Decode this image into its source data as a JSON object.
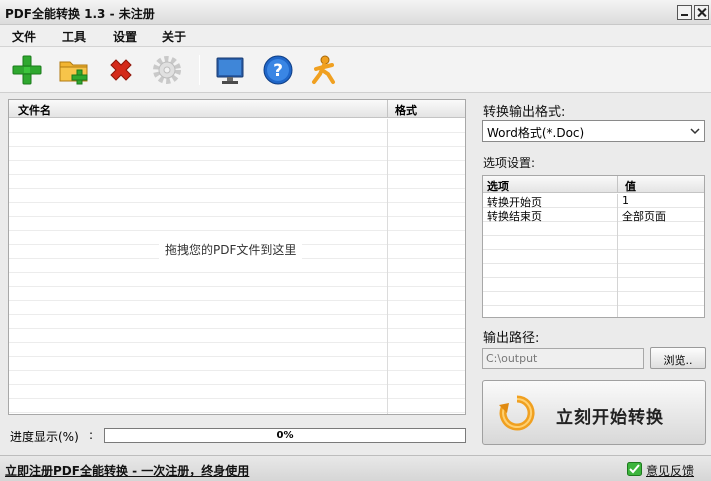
{
  "window": {
    "title": "PDF全能转换 1.3 - 未注册"
  },
  "menu": {
    "items": [
      "文件",
      "工具",
      "设置",
      "关于"
    ]
  },
  "toolbar": {
    "buttons": [
      {
        "icon": "add-file-icon"
      },
      {
        "icon": "add-folder-icon"
      },
      {
        "icon": "delete-icon"
      },
      {
        "icon": "settings-icon"
      },
      {
        "icon": "monitor-icon"
      },
      {
        "icon": "help-icon"
      },
      {
        "icon": "running-man-icon"
      }
    ]
  },
  "file_list": {
    "headers": {
      "name": "文件名",
      "format": "格式"
    },
    "drop_hint": "拖拽您的PDF文件到这里"
  },
  "progress": {
    "label": "进度显示(%)",
    "colon": ":",
    "value_percent": 0,
    "text": "0%"
  },
  "output_format": {
    "label": "转换输出格式:",
    "selected": "Word格式(*.Doc)"
  },
  "options": {
    "label": "选项设置:",
    "headers": {
      "option": "选项",
      "value": "值"
    },
    "rows": [
      {
        "option": "转换开始页",
        "value": "1"
      },
      {
        "option": "转换结束页",
        "value": "全部页面"
      }
    ]
  },
  "output_path": {
    "label": "输出路径:",
    "value": "C:\\output",
    "browse_label": "浏览.."
  },
  "start": {
    "label": "立刻开始转换"
  },
  "status": {
    "register_link": "立即注册PDF全能转换 - 一次注册，终身使用",
    "feedback": "意见反馈"
  },
  "colors": {
    "accent": "#6b9be0",
    "brand_green": "#2fa82f",
    "delete_red": "#d42a1a",
    "help_blue": "#1f66c8",
    "start_orange": "#f0a020"
  }
}
